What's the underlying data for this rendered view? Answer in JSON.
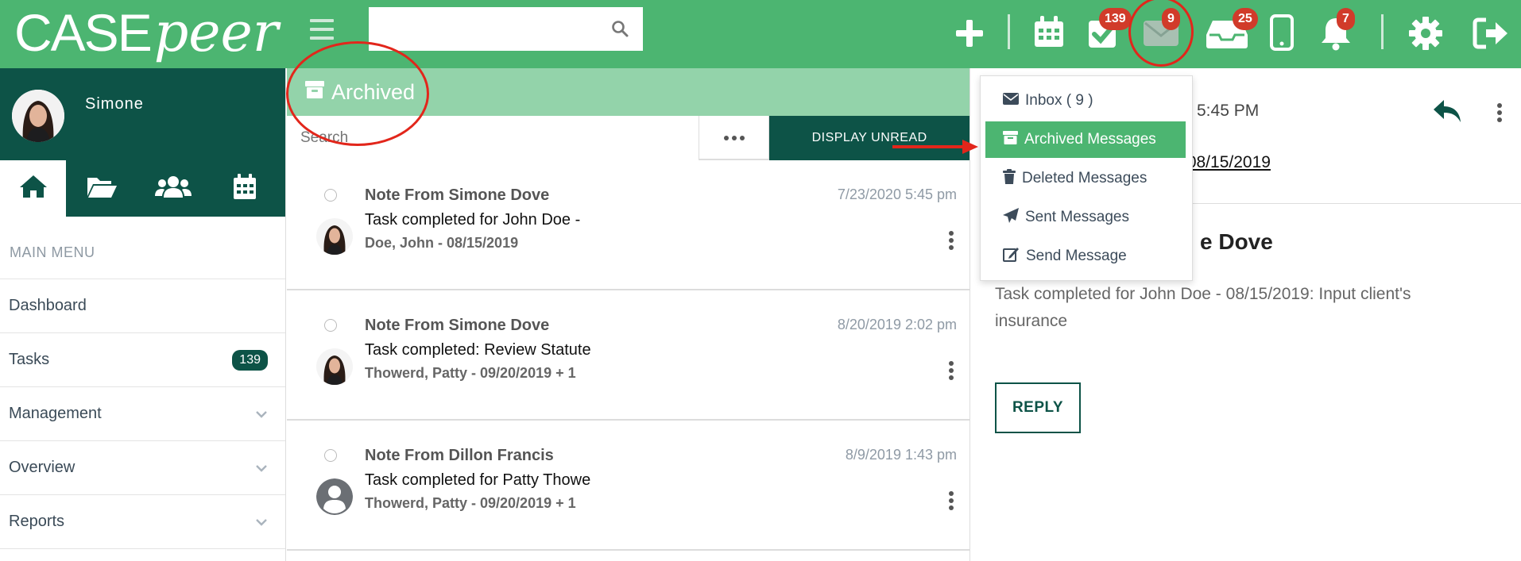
{
  "brand": {
    "logo_case": "CASE",
    "logo_peer": "peer"
  },
  "topbar": {
    "search": {
      "placeholder": "",
      "value": ""
    },
    "badges": {
      "tasks": "139",
      "messages": "9",
      "inbox": "25",
      "notifications": "7"
    },
    "colors": {
      "bar": "#4cb571",
      "badge": "#d13b2a"
    }
  },
  "sidebar": {
    "user_name": "Simone",
    "main_menu_label": "MAIN MENU",
    "items": [
      {
        "label": "Dashboard"
      },
      {
        "label": "Tasks",
        "count": "139"
      },
      {
        "label": "Management"
      },
      {
        "label": "Overview"
      },
      {
        "label": "Reports"
      }
    ]
  },
  "list": {
    "header": "Archived",
    "search_placeholder": "Search",
    "display_unread": "DISPLAY UNREAD",
    "messages": [
      {
        "from": "Note From Simone Dove",
        "subject": "Task completed for John Doe -",
        "case": "Doe, John - 08/15/2019",
        "date": "7/23/2020 5:45 pm"
      },
      {
        "from": "Note From Simone Dove",
        "subject": "Task completed: Review Statute",
        "case": "Thowerd, Patty - 09/20/2019 + 1",
        "date": "8/20/2019 2:02 pm"
      },
      {
        "from": "Note From Dillon Francis",
        "subject": "Task completed for Patty Thowe",
        "case": "Thowerd, Patty - 09/20/2019 + 1",
        "date": "8/9/2019 1:43 pm"
      }
    ]
  },
  "detail": {
    "time": "5:45 PM",
    "case_link": "- 08/15/2019",
    "title": "e Dove",
    "body": "Task completed for John Doe - 08/15/2019: Input client's insurance",
    "reply": "REPLY"
  },
  "dropdown": {
    "items": [
      {
        "label": "Inbox ( 9 )",
        "icon": "envelope-icon"
      },
      {
        "label": "Archived Messages",
        "icon": "archive-icon",
        "selected": true
      },
      {
        "label": "Deleted Messages",
        "icon": "trash-icon"
      },
      {
        "label": "Sent Messages",
        "icon": "paper-plane-icon"
      },
      {
        "label": "Send Message",
        "icon": "edit-icon"
      }
    ]
  }
}
